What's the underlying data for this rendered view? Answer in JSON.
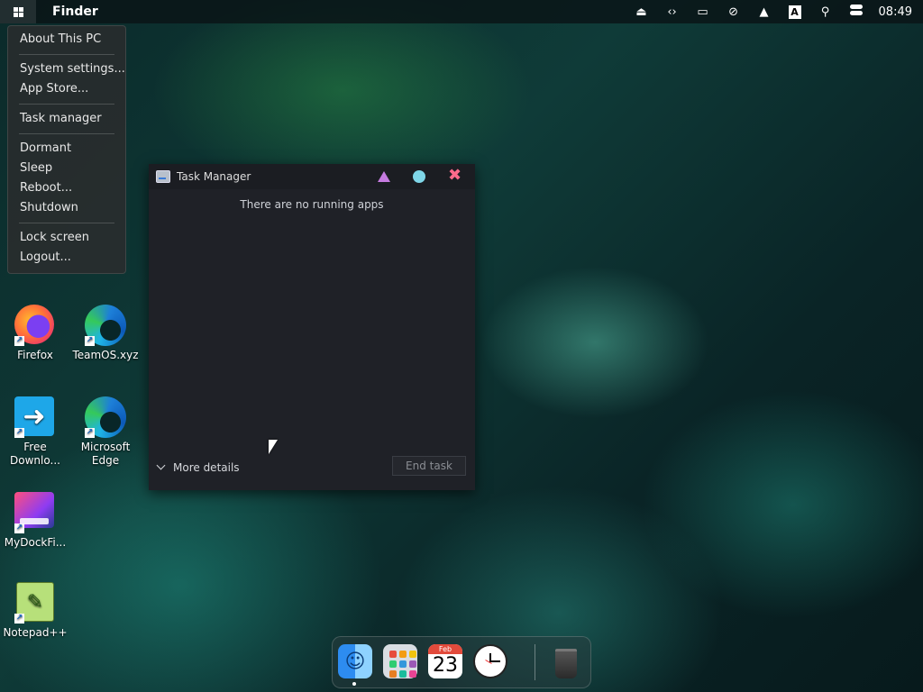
{
  "topbar": {
    "app_title": "Finder",
    "clock": "08:49",
    "keyboard_indicator": "A",
    "tray_icons": [
      "eject-icon",
      "code-icon",
      "monitor-icon",
      "network-off-icon",
      "upload-icon",
      "keyboard-icon",
      "search-icon",
      "control-center-icon"
    ]
  },
  "start_menu": {
    "items": [
      "About This PC",
      "System settings...",
      "App Store...",
      "Task manager",
      "Dormant",
      "Sleep",
      "Reboot...",
      "Shutdown",
      "Lock screen",
      "Logout..."
    ]
  },
  "desktop": {
    "icons": [
      {
        "label": "Firefox"
      },
      {
        "label": "TeamOS.xyz"
      },
      {
        "label": "Free Downlo..."
      },
      {
        "label": "Microsoft Edge"
      },
      {
        "label": "MyDockFi..."
      },
      {
        "label": "Notepad++"
      }
    ]
  },
  "task_manager": {
    "title": "Task Manager",
    "empty_message": "There are no running apps",
    "more_details": "More details",
    "end_task": "End task"
  },
  "dock": {
    "calendar_month": "Feb",
    "calendar_day": "23",
    "launchpad_colors": [
      "#e74c3c",
      "#f39c12",
      "#f1c40f",
      "#2ecc71",
      "#3498db",
      "#9b59b6",
      "#e67e22",
      "#1abc9c",
      "#e84393"
    ]
  },
  "colors": {
    "window_bg": "#1f2127",
    "close_button": "#ff6b8b",
    "minimize_button": "#c67be0",
    "maximize_button": "#7fd6e8"
  }
}
